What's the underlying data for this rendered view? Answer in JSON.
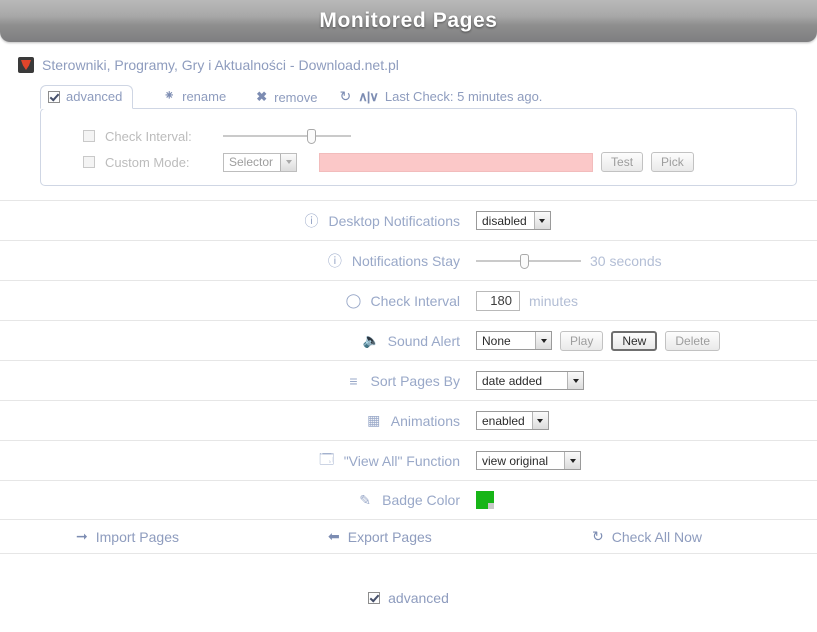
{
  "header": {
    "title": "Monitored Pages"
  },
  "monitored_page": {
    "favicon": "favicon-icon",
    "title": "Sterowniki, Programy, Gry i Aktualności - Download.net.pl",
    "tabs": {
      "advanced_label": "advanced",
      "advanced_checked": true
    },
    "tools": {
      "rename_label": "rename",
      "rename_icon": "text-cursor-icon",
      "remove_label": "remove",
      "remove_icon": "close-x-icon",
      "refresh_icon": "refresh-icon",
      "pulse_icon": "pulse-icon",
      "last_check_label": "Last Check: 5 minutes ago."
    },
    "advanced_panel": {
      "check_interval": {
        "label": "Check Interval:",
        "checked": false,
        "slider_percent": 72
      },
      "custom_mode": {
        "label": "Custom Mode:",
        "checked": false,
        "mode_value": "Selector",
        "input_value": "",
        "test_label": "Test",
        "pick_label": "Pick"
      }
    }
  },
  "settings": [
    {
      "icon": "exclamation-circle-icon",
      "name": "Desktop Notifications",
      "control": "select",
      "value": "disabled"
    },
    {
      "icon": "exclamation-circle-icon",
      "name": "Notifications Stay",
      "control": "slider",
      "slider_percent": 44,
      "value_text": "30 seconds"
    },
    {
      "icon": "clock-icon",
      "name": "Check Interval",
      "control": "number",
      "value": "180",
      "unit": "minutes"
    },
    {
      "icon": "speaker-icon",
      "name": "Sound Alert",
      "control": "sound",
      "value": "None",
      "play_label": "Play",
      "new_label": "New",
      "delete_label": "Delete"
    },
    {
      "icon": "sort-icon",
      "name": "Sort Pages By",
      "control": "select",
      "value": "date added"
    },
    {
      "icon": "film-icon",
      "name": "Animations",
      "control": "select",
      "value": "enabled"
    },
    {
      "icon": "windows-icon",
      "name": "\"View All\" Function",
      "control": "select",
      "value": "view original"
    },
    {
      "icon": "pencil-icon",
      "name": "Badge Color",
      "control": "color",
      "value": "#17b517"
    }
  ],
  "actions": {
    "import": {
      "label": "Import Pages",
      "icon": "arrow-right-icon"
    },
    "export": {
      "label": "Export Pages",
      "icon": "arrow-left-icon"
    },
    "check_all": {
      "label": "Check All Now",
      "icon": "refresh-icon"
    }
  },
  "footer": {
    "advanced_label": "advanced",
    "advanced_checked": true
  }
}
